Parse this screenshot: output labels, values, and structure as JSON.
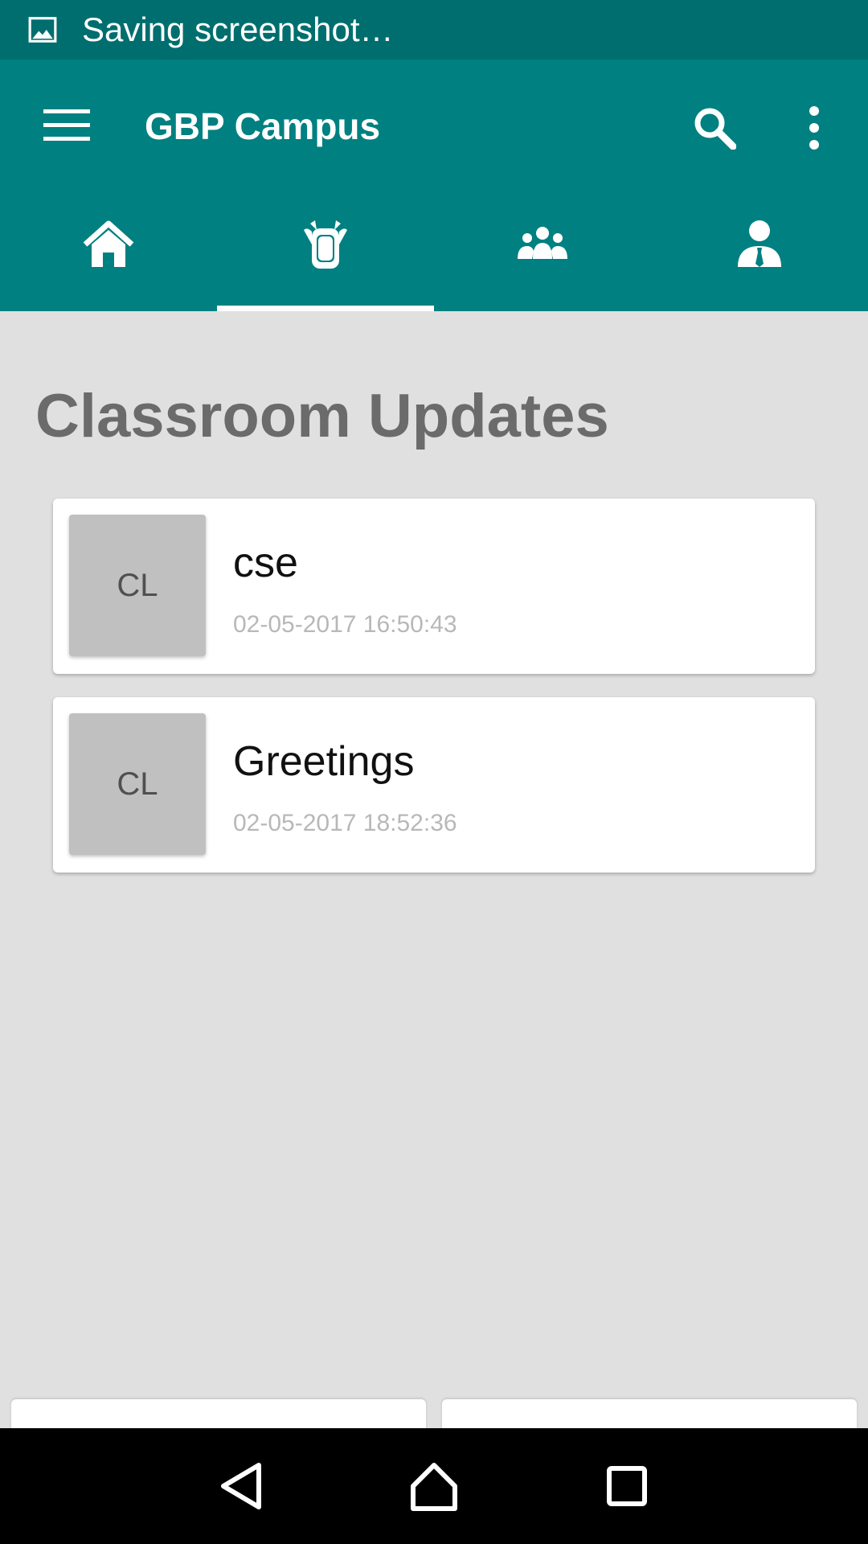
{
  "status_bar": {
    "icon": "image-icon",
    "text": "Saving screenshot…"
  },
  "app_bar": {
    "title": "GBP Campus",
    "menu_icon": "menu-icon",
    "search_icon": "search-icon",
    "more_icon": "more-vertical-icon"
  },
  "tabs": [
    {
      "icon": "home-icon",
      "active": false
    },
    {
      "icon": "backpack-icon",
      "active": true
    },
    {
      "icon": "group-icon",
      "active": false
    },
    {
      "icon": "person-tie-icon",
      "active": false
    }
  ],
  "main": {
    "title": "Classroom Updates",
    "items": [
      {
        "thumb": "CL",
        "title": "cse",
        "date": "02-05-2017 16:50:43"
      },
      {
        "thumb": "CL",
        "title": "Greetings",
        "date": "02-05-2017 18:52:36"
      }
    ]
  },
  "nav_bar": {
    "back_icon": "back-triangle-icon",
    "home_icon": "home-outline-icon",
    "recents_icon": "recents-square-icon"
  },
  "colors": {
    "primary": "#008080",
    "status_bar": "#006e6e",
    "background": "#e0e0e0"
  }
}
